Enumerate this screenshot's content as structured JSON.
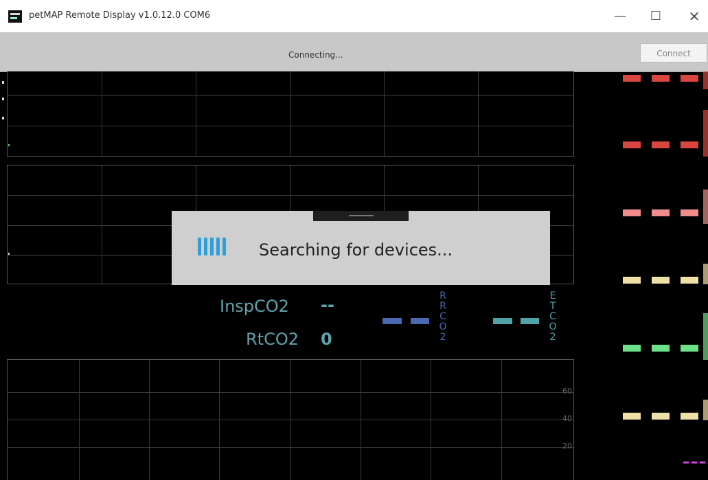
{
  "window": {
    "title": "petMAP Remote Display v1.0.12.0   COM6",
    "minimize_glyph": "—",
    "maximize_glyph": "☐",
    "close_glyph": "✕"
  },
  "status": {
    "text": "Connecting...",
    "connect_label": "Connect"
  },
  "dialog": {
    "message": "Searching for devices..."
  },
  "readouts": {
    "insp_label": "InspCO2",
    "insp_value": "--",
    "rt_label": "RtCO2",
    "rt_value": "0"
  },
  "vertical_labels": {
    "rrco2": [
      "R",
      "R",
      "C",
      "O",
      "2"
    ],
    "etco2": [
      "E",
      "T",
      "C",
      "O",
      "2"
    ]
  },
  "graph3": {
    "ticks": [
      "60",
      "40",
      "20"
    ]
  },
  "colors": {
    "red": "#d9463f",
    "pink": "#f08c8c",
    "yellow": "#efe0a8",
    "green": "#6ee08a",
    "blue": "#4b68b0",
    "teal": "#4fa2a8",
    "magenta": "#d23ce6"
  }
}
